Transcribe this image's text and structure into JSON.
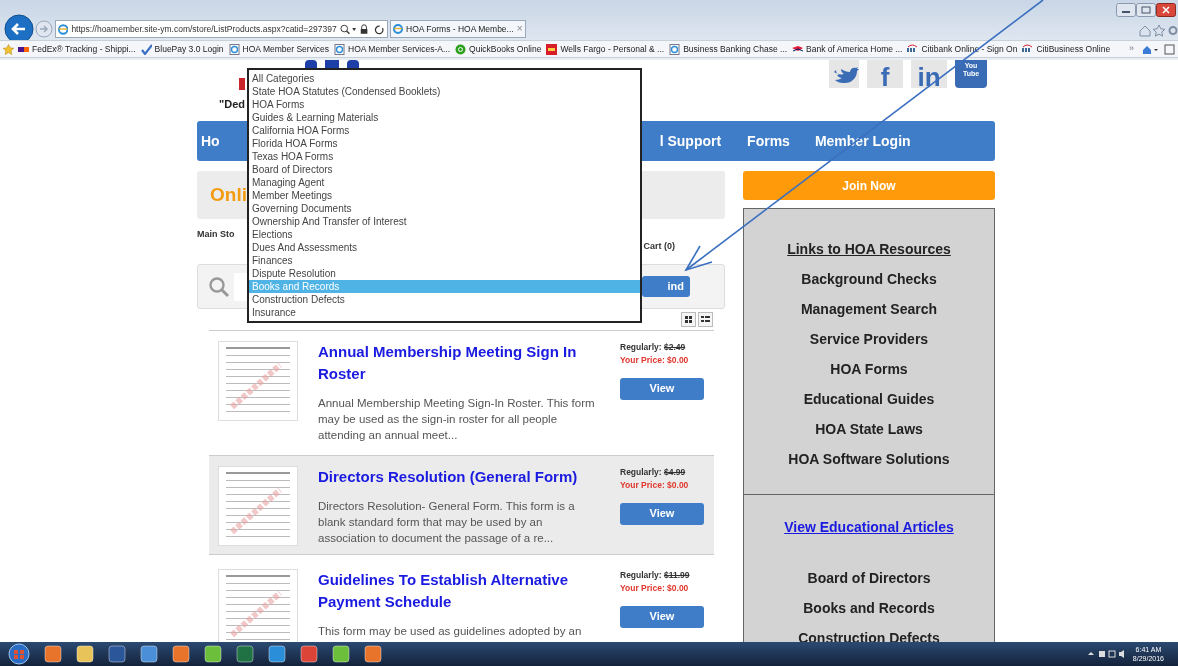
{
  "browser": {
    "address": "https://hoamember.site-ym.com/store/ListProducts.aspx?catid=297397",
    "tab": {
      "title": "HOA Forms - HOA Membe...",
      "close": "×"
    },
    "favorites": [
      {
        "label": "FedEx® Tracking - Shippi...",
        "kind": "fedex"
      },
      {
        "label": "BluePay 3.0 Login",
        "kind": "check"
      },
      {
        "label": "HOA Member Services",
        "kind": "page"
      },
      {
        "label": "HOA Member Services-A...",
        "kind": "page"
      },
      {
        "label": "QuickBooks Online",
        "kind": "quickbooks"
      },
      {
        "label": "Wells Fargo - Personal & ...",
        "kind": "bank"
      },
      {
        "label": "Business Banking  Chase ...",
        "kind": "page"
      },
      {
        "label": "Bank of America  Home  ...",
        "kind": "flag"
      },
      {
        "label": "Citibank Online - Sign On",
        "kind": "citi"
      },
      {
        "label": "CitiBusiness Online",
        "kind": "citi"
      }
    ],
    "overflow": "»"
  },
  "page": {
    "tagline": "\"Ded",
    "social": [
      {
        "kind": "twitter"
      },
      {
        "kind": "facebook",
        "glyph": "f"
      },
      {
        "kind": "linkedin",
        "glyph": "in"
      },
      {
        "kind": "youtube",
        "glyph": "You Tube"
      }
    ],
    "nav": [
      {
        "label": "Ho"
      },
      {
        "label": "l Support"
      },
      {
        "label": "Forms"
      },
      {
        "label": "Member Login"
      }
    ],
    "store_heading": "Onli",
    "breadcrumb": "Main Sto",
    "cart": "Cart (0)",
    "find_button": "ind",
    "category_dropdown": {
      "options": [
        {
          "label": "All Categories",
          "selected": false
        },
        {
          "label": "State HOA Statutes (Condensed Booklets)",
          "selected": false
        },
        {
          "label": "HOA Forms",
          "selected": false
        },
        {
          "label": "Guides & Learning Materials",
          "selected": false
        },
        {
          "label": "California HOA Forms",
          "selected": false
        },
        {
          "label": "Florida HOA Forms",
          "selected": false
        },
        {
          "label": "Texas HOA Forms",
          "selected": false
        },
        {
          "label": "Board of Directors",
          "selected": false
        },
        {
          "label": "Managing Agent",
          "selected": false
        },
        {
          "label": "Member Meetings",
          "selected": false
        },
        {
          "label": "Governing Documents",
          "selected": false
        },
        {
          "label": "Ownership And Transfer of Interest",
          "selected": false
        },
        {
          "label": "Elections",
          "selected": false
        },
        {
          "label": "Dues And Assessments",
          "selected": false
        },
        {
          "label": "Finances",
          "selected": false
        },
        {
          "label": "Dispute Resolution",
          "selected": false
        },
        {
          "label": "Books and Records",
          "selected": true
        },
        {
          "label": "Construction Defects",
          "selected": false
        },
        {
          "label": "Insurance",
          "selected": false
        }
      ]
    },
    "products": [
      {
        "title": "Annual Membership Meeting Sign In Roster",
        "description": "Annual Membership Meeting Sign-In Roster.   This form may be used as the sign-in roster for all people attending an annual meet...",
        "regular_label": "Regularly:",
        "regular_price": "$2.49",
        "your_price_label": "Your Price:",
        "your_price": "$0.00",
        "button": "View",
        "highlighted": false
      },
      {
        "title": "Directors Resolution (General Form)",
        "description": "Directors Resolution- General Form. This form is a blank standard form that may be used by an association to document the passage of a re...",
        "regular_label": "Regularly:",
        "regular_price": "$4.99",
        "your_price_label": "Your Price:",
        "your_price": "$0.00",
        "button": "View",
        "highlighted": true
      },
      {
        "title": "Guidelines To Establish Alternative Payment Schedule",
        "description": "This form may be used as guidelines adopted by an",
        "regular_label": "Regularly:",
        "regular_price": "$11.99",
        "your_price_label": "Your Price:",
        "your_price": "$0.00",
        "button": "View",
        "highlighted": false
      }
    ],
    "sidebar": {
      "join_button": "Join Now",
      "resources_title": "Links to HOA Resources",
      "resources": [
        "Background Checks",
        "Management Search",
        "Service Providers",
        "HOA Forms",
        "Educational Guides",
        "HOA State Laws",
        "HOA Software Solutions"
      ],
      "articles_link": "View Educational Articles",
      "topics": [
        "Board of Directors",
        "Books and Records",
        "Construction Defects"
      ]
    }
  },
  "taskbar": {
    "time": "6:41 AM",
    "date": "8/29/2016"
  }
}
